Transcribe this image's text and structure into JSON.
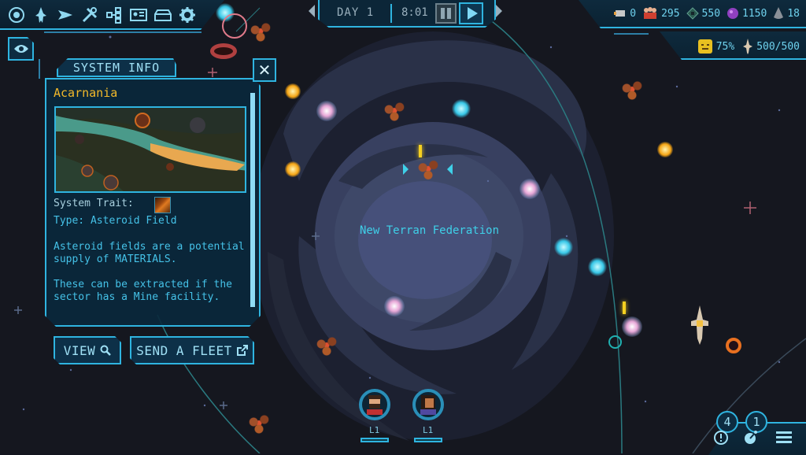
{
  "toolbar": {
    "icons": [
      {
        "name": "galaxy-icon"
      },
      {
        "name": "fleet-icon"
      },
      {
        "name": "ship-icon"
      },
      {
        "name": "tools-icon"
      },
      {
        "name": "tech-tree-icon"
      },
      {
        "name": "personnel-card-icon"
      },
      {
        "name": "storage-icon"
      },
      {
        "name": "settings-gear-icon"
      }
    ]
  },
  "time": {
    "day": "DAY 1",
    "clock": "8:01",
    "paused": true
  },
  "resources": {
    "top": [
      {
        "icon": "transport-icon",
        "value": "0"
      },
      {
        "icon": "crew-icon",
        "value": "295"
      },
      {
        "icon": "materials-icon",
        "value": "550"
      },
      {
        "icon": "energy-orb-icon",
        "value": "1150"
      },
      {
        "icon": "crystal-icon",
        "value": "18"
      }
    ],
    "morale": {
      "icon": "morale-face-icon",
      "value": "75%"
    },
    "fleet_capacity": {
      "icon": "fleet-capacity-icon",
      "value": "500/500"
    }
  },
  "system_info": {
    "tab_title": "SYSTEM INFO",
    "name": "Acarnania",
    "trait_label": "System Trait:",
    "type_label": "Type: Asteroid Field",
    "description_1": "Asteroid fields are a potential supply of MATERIALS.",
    "description_2": "These can be extracted if the sector has a Mine facility.",
    "view_label": "VIEW",
    "send_fleet_label": "SEND A FLEET",
    "colors": {
      "name": "#f2b92a",
      "text": "#45c2e8",
      "border": "#2fb4e0"
    }
  },
  "map": {
    "faction_label": "New Terran Federation"
  },
  "captains": [
    {
      "level": "L1"
    },
    {
      "level": "L1"
    }
  ],
  "bottom_right": {
    "alerts_count": "4",
    "research_count": "1"
  }
}
